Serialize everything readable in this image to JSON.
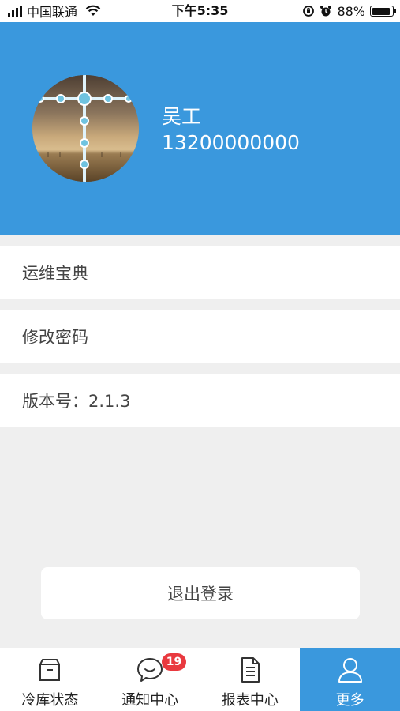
{
  "status_bar": {
    "carrier": "中国联通",
    "time": "下午5:35",
    "battery_percent": "88%",
    "battery_level": 0.88,
    "icons": [
      "signal-icon",
      "wifi-icon",
      "lock-rotation-icon",
      "alarm-icon",
      "battery-icon"
    ]
  },
  "profile": {
    "name": "吴工",
    "phone": "13200000000"
  },
  "menu": {
    "items": [
      {
        "label": "运维宝典"
      },
      {
        "label": "修改密码"
      },
      {
        "label": "版本号：2.1.3"
      }
    ]
  },
  "logout": {
    "label": "退出登录"
  },
  "tabbar": {
    "tabs": [
      {
        "label": "冷库状态",
        "icon": "box-icon",
        "active": false
      },
      {
        "label": "通知中心",
        "icon": "chat-bubble-icon",
        "active": false,
        "badge": "19"
      },
      {
        "label": "报表中心",
        "icon": "document-icon",
        "active": false
      },
      {
        "label": "更多",
        "icon": "user-icon",
        "active": true
      }
    ]
  },
  "colors": {
    "header": "#3a98dd",
    "background": "#efefef",
    "badge": "#e9393f",
    "active_tab": "#3a98dd"
  }
}
